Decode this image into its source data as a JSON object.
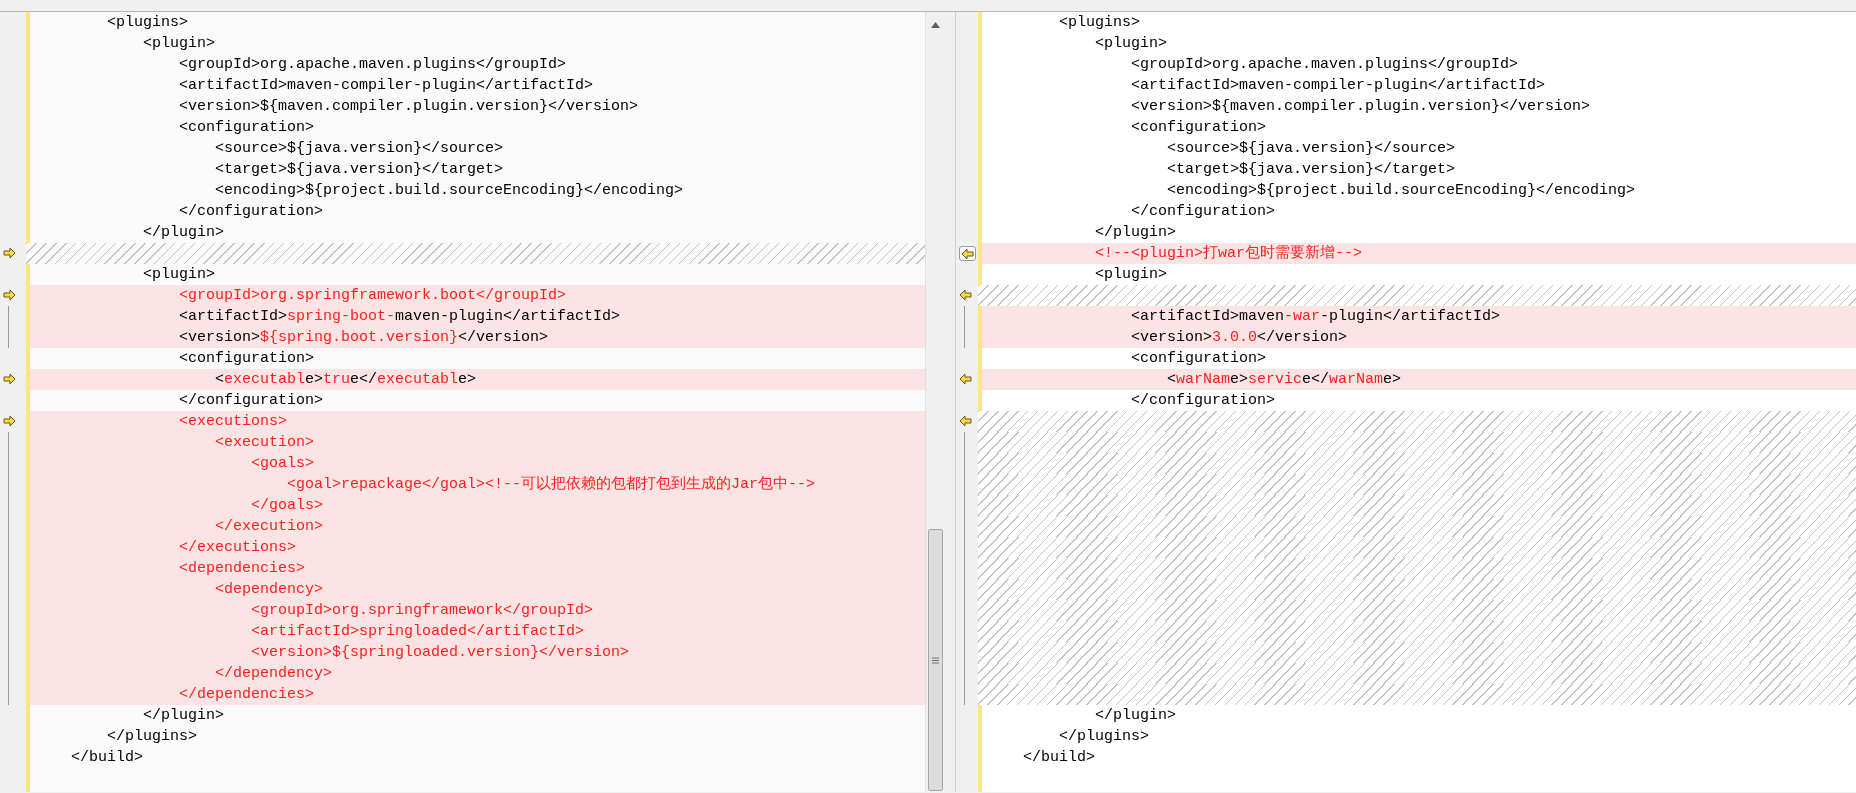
{
  "panes": [
    {
      "lines": [
        {
          "kind": "code",
          "changed": false,
          "segments": [
            {
              "text": "        <plugins>",
              "changed": false
            }
          ]
        },
        {
          "kind": "code",
          "changed": false,
          "segments": [
            {
              "text": "            <plugin>",
              "changed": false
            }
          ]
        },
        {
          "kind": "code",
          "changed": false,
          "segments": [
            {
              "text": "                <groupId>org.apache.maven.plugins</groupId>",
              "changed": false
            }
          ]
        },
        {
          "kind": "code",
          "changed": false,
          "segments": [
            {
              "text": "                <artifactId>maven-compiler-plugin</artifactId>",
              "changed": false
            }
          ]
        },
        {
          "kind": "code",
          "changed": false,
          "segments": [
            {
              "text": "                <version>${maven.compiler.plugin.version}</version>",
              "changed": false
            }
          ]
        },
        {
          "kind": "code",
          "changed": false,
          "segments": [
            {
              "text": "                <configuration>",
              "changed": false
            }
          ]
        },
        {
          "kind": "code",
          "changed": false,
          "segments": [
            {
              "text": "                    <source>${java.version}</source>",
              "changed": false
            }
          ]
        },
        {
          "kind": "code",
          "changed": false,
          "segments": [
            {
              "text": "                    <target>${java.version}</target>",
              "changed": false
            }
          ]
        },
        {
          "kind": "code",
          "changed": false,
          "segments": [
            {
              "text": "                    <encoding>${project.build.sourceEncoding}</encoding>",
              "changed": false
            }
          ]
        },
        {
          "kind": "code",
          "changed": false,
          "segments": [
            {
              "text": "                </configuration>",
              "changed": false
            }
          ]
        },
        {
          "kind": "code",
          "changed": false,
          "segments": [
            {
              "text": "            </plugin>",
              "changed": false
            }
          ]
        },
        {
          "kind": "gap",
          "marker": true,
          "boxed": false
        },
        {
          "kind": "code",
          "changed": false,
          "segments": [
            {
              "text": "            <plugin>",
              "changed": false
            }
          ]
        },
        {
          "kind": "code",
          "changed": true,
          "marker": true,
          "boxed": false,
          "segments": [
            {
              "text": "                <groupId>org.springframework.boot</groupId>",
              "changed": true
            }
          ]
        },
        {
          "kind": "code",
          "changed": true,
          "bracket": true,
          "segments": [
            {
              "text": "                <artifactId>",
              "changed": false
            },
            {
              "text": "spring-boot-",
              "changed": true
            },
            {
              "text": "maven-plugin</artifactId>",
              "changed": false
            }
          ]
        },
        {
          "kind": "code",
          "changed": true,
          "bracket": true,
          "segments": [
            {
              "text": "                <version>",
              "changed": false
            },
            {
              "text": "${spring.boot.version}",
              "changed": true
            },
            {
              "text": "</version>",
              "changed": false
            }
          ]
        },
        {
          "kind": "code",
          "changed": false,
          "segments": [
            {
              "text": "                <configuration>",
              "changed": false
            }
          ]
        },
        {
          "kind": "code",
          "changed": true,
          "marker": true,
          "boxed": false,
          "segments": [
            {
              "text": "                    <",
              "changed": false
            },
            {
              "text": "executabl",
              "changed": true
            },
            {
              "text": "e>",
              "changed": false
            },
            {
              "text": "tru",
              "changed": true
            },
            {
              "text": "e</",
              "changed": false
            },
            {
              "text": "executabl",
              "changed": true
            },
            {
              "text": "e>",
              "changed": false
            }
          ]
        },
        {
          "kind": "code",
          "changed": false,
          "segments": [
            {
              "text": "                </configuration>",
              "changed": false
            }
          ]
        },
        {
          "kind": "code",
          "changed": true,
          "marker": true,
          "boxed": false,
          "segments": [
            {
              "text": "                <executions>",
              "changed": true
            }
          ]
        },
        {
          "kind": "code",
          "changed": true,
          "bracket": true,
          "segments": [
            {
              "text": "                    <execution>",
              "changed": true
            }
          ]
        },
        {
          "kind": "code",
          "changed": true,
          "bracket": true,
          "segments": [
            {
              "text": "                        <goals>",
              "changed": true
            }
          ]
        },
        {
          "kind": "code",
          "changed": true,
          "bracket": true,
          "segments": [
            {
              "text": "                            <goal>repackage</goal><!--可以把依赖的包都打包到生成的Jar包中-->",
              "changed": true
            }
          ]
        },
        {
          "kind": "code",
          "changed": true,
          "bracket": true,
          "segments": [
            {
              "text": "                        </goals>",
              "changed": true
            }
          ]
        },
        {
          "kind": "code",
          "changed": true,
          "bracket": true,
          "segments": [
            {
              "text": "                    </execution>",
              "changed": true
            }
          ]
        },
        {
          "kind": "code",
          "changed": true,
          "bracket": true,
          "segments": [
            {
              "text": "                </executions>",
              "changed": true
            }
          ]
        },
        {
          "kind": "code",
          "changed": true,
          "bracket": true,
          "segments": [
            {
              "text": "                <dependencies>",
              "changed": true
            }
          ]
        },
        {
          "kind": "code",
          "changed": true,
          "bracket": true,
          "segments": [
            {
              "text": "                    <dependency>",
              "changed": true
            }
          ]
        },
        {
          "kind": "code",
          "changed": true,
          "bracket": true,
          "segments": [
            {
              "text": "                        <groupId>org.springframework</groupId>",
              "changed": true
            }
          ]
        },
        {
          "kind": "code",
          "changed": true,
          "bracket": true,
          "segments": [
            {
              "text": "                        <artifactId>springloaded</artifactId>",
              "changed": true
            }
          ]
        },
        {
          "kind": "code",
          "changed": true,
          "bracket": true,
          "segments": [
            {
              "text": "                        <version>${springloaded.version}</version>",
              "changed": true
            }
          ]
        },
        {
          "kind": "code",
          "changed": true,
          "bracket": true,
          "segments": [
            {
              "text": "                    </dependency>",
              "changed": true
            }
          ]
        },
        {
          "kind": "code",
          "changed": true,
          "bracket": true,
          "segments": [
            {
              "text": "                </dependencies>",
              "changed": true
            }
          ]
        },
        {
          "kind": "code",
          "changed": false,
          "segments": [
            {
              "text": "            </plugin>",
              "changed": false
            }
          ]
        },
        {
          "kind": "code",
          "changed": false,
          "segments": [
            {
              "text": "        </plugins>",
              "changed": false
            }
          ]
        },
        {
          "kind": "code",
          "changed": false,
          "segments": [
            {
              "text": "    </build>",
              "changed": false
            }
          ]
        }
      ]
    },
    {
      "lines": [
        {
          "kind": "code",
          "changed": false,
          "segments": [
            {
              "text": "        <plugins>",
              "changed": false
            }
          ]
        },
        {
          "kind": "code",
          "changed": false,
          "segments": [
            {
              "text": "            <plugin>",
              "changed": false
            }
          ]
        },
        {
          "kind": "code",
          "changed": false,
          "segments": [
            {
              "text": "                <groupId>org.apache.maven.plugins</groupId>",
              "changed": false
            }
          ]
        },
        {
          "kind": "code",
          "changed": false,
          "segments": [
            {
              "text": "                <artifactId>maven-compiler-plugin</artifactId>",
              "changed": false
            }
          ]
        },
        {
          "kind": "code",
          "changed": false,
          "segments": [
            {
              "text": "                <version>${maven.compiler.plugin.version}</version>",
              "changed": false
            }
          ]
        },
        {
          "kind": "code",
          "changed": false,
          "segments": [
            {
              "text": "                <configuration>",
              "changed": false
            }
          ]
        },
        {
          "kind": "code",
          "changed": false,
          "segments": [
            {
              "text": "                    <source>${java.version}</source>",
              "changed": false
            }
          ]
        },
        {
          "kind": "code",
          "changed": false,
          "segments": [
            {
              "text": "                    <target>${java.version}</target>",
              "changed": false
            }
          ]
        },
        {
          "kind": "code",
          "changed": false,
          "segments": [
            {
              "text": "                    <encoding>${project.build.sourceEncoding}</encoding>",
              "changed": false
            }
          ]
        },
        {
          "kind": "code",
          "changed": false,
          "segments": [
            {
              "text": "                </configuration>",
              "changed": false
            }
          ]
        },
        {
          "kind": "code",
          "changed": false,
          "segments": [
            {
              "text": "            </plugin>",
              "changed": false
            }
          ]
        },
        {
          "kind": "code",
          "changed": true,
          "marker": true,
          "boxed": true,
          "segments": [
            {
              "text": "            <!--<plugin>打war包时需要新增-->",
              "changed": true
            }
          ]
        },
        {
          "kind": "code",
          "changed": false,
          "segments": [
            {
              "text": "            <plugin>",
              "changed": false
            }
          ]
        },
        {
          "kind": "gap",
          "marker": true,
          "boxed": false
        },
        {
          "kind": "code",
          "changed": true,
          "bracket": true,
          "segments": [
            {
              "text": "                <artifactId>maven",
              "changed": false
            },
            {
              "text": "-war",
              "changed": true
            },
            {
              "text": "-plugin</artifactId>",
              "changed": false
            }
          ]
        },
        {
          "kind": "code",
          "changed": true,
          "bracket": true,
          "segments": [
            {
              "text": "                <version>",
              "changed": false
            },
            {
              "text": "3.0.0",
              "changed": true
            },
            {
              "text": "</version>",
              "changed": false
            }
          ]
        },
        {
          "kind": "code",
          "changed": false,
          "segments": [
            {
              "text": "                <configuration>",
              "changed": false
            }
          ]
        },
        {
          "kind": "code",
          "changed": true,
          "marker": true,
          "boxed": false,
          "segments": [
            {
              "text": "                    <",
              "changed": false
            },
            {
              "text": "warNam",
              "changed": true
            },
            {
              "text": "e>",
              "changed": false
            },
            {
              "text": "servic",
              "changed": true
            },
            {
              "text": "e</",
              "changed": false
            },
            {
              "text": "warNam",
              "changed": true
            },
            {
              "text": "e>",
              "changed": false
            }
          ]
        },
        {
          "kind": "code",
          "changed": false,
          "segments": [
            {
              "text": "                </configuration>",
              "changed": false
            }
          ]
        },
        {
          "kind": "gap",
          "marker": true,
          "boxed": false
        },
        {
          "kind": "gap",
          "bracket": true
        },
        {
          "kind": "gap",
          "bracket": true
        },
        {
          "kind": "gap",
          "bracket": true
        },
        {
          "kind": "gap",
          "bracket": true
        },
        {
          "kind": "gap",
          "bracket": true
        },
        {
          "kind": "gap",
          "bracket": true
        },
        {
          "kind": "gap",
          "bracket": true
        },
        {
          "kind": "gap",
          "bracket": true
        },
        {
          "kind": "gap",
          "bracket": true
        },
        {
          "kind": "gap",
          "bracket": true
        },
        {
          "kind": "gap",
          "bracket": true
        },
        {
          "kind": "gap",
          "bracket": true
        },
        {
          "kind": "gap",
          "bracket": true
        },
        {
          "kind": "code",
          "changed": false,
          "segments": [
            {
              "text": "            </plugin>",
              "changed": false
            }
          ]
        },
        {
          "kind": "code",
          "changed": false,
          "segments": [
            {
              "text": "        </plugins>",
              "changed": false
            }
          ]
        },
        {
          "kind": "code",
          "changed": false,
          "segments": [
            {
              "text": "    </build>",
              "changed": false
            }
          ]
        }
      ]
    }
  ]
}
